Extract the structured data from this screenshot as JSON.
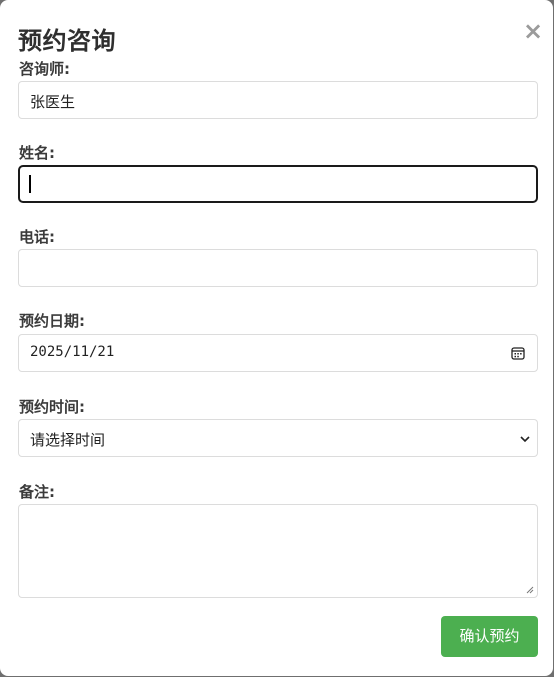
{
  "dialog": {
    "title": "预约咨询",
    "close_label": "×"
  },
  "form": {
    "counselor": {
      "label": "咨询师:",
      "value": "张医生"
    },
    "name": {
      "label": "姓名:",
      "value": ""
    },
    "phone": {
      "label": "电话:",
      "value": ""
    },
    "date": {
      "label": "预约日期:",
      "value": "2025/11/21"
    },
    "time": {
      "label": "预约时间:",
      "selected": "请选择时间"
    },
    "notes": {
      "label": "备注:",
      "value": ""
    }
  },
  "actions": {
    "submit_label": "确认预约"
  },
  "colors": {
    "submit_bg": "#4caf50",
    "title": "#2f2f2f",
    "close": "#9b9b9b"
  },
  "icons": {
    "close": "close-icon",
    "date_picker": "calendar-icon",
    "select_arrow": "chevron-down-icon",
    "resize": "resize-grip-icon"
  }
}
